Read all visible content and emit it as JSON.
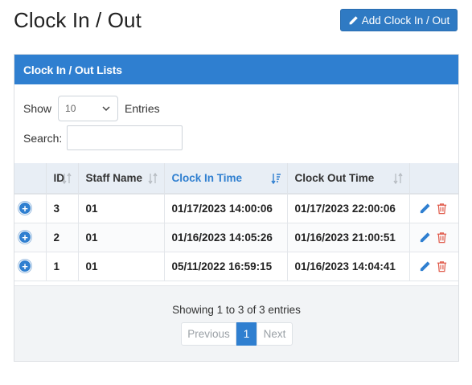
{
  "page": {
    "title": "Clock In / Out"
  },
  "toolbar": {
    "add_label": "Add Clock In / Out"
  },
  "card": {
    "header": "Clock In / Out Lists"
  },
  "controls": {
    "show_label": "Show",
    "entries_value": "10",
    "entries_label": "Entries",
    "search_label": "Search:",
    "search_value": ""
  },
  "table": {
    "columns": [
      "",
      "ID",
      "Staff Name",
      "Clock In Time",
      "Clock Out Time",
      ""
    ],
    "sorted_column": "Clock In Time",
    "rows": [
      {
        "id": "3",
        "staff": "01",
        "clock_in": "01/17/2023 14:00:06",
        "clock_out": "01/17/2023 22:00:06"
      },
      {
        "id": "2",
        "staff": "01",
        "clock_in": "01/16/2023 14:05:26",
        "clock_out": "01/16/2023 21:00:51"
      },
      {
        "id": "1",
        "staff": "01",
        "clock_in": "05/11/2022 16:59:15",
        "clock_out": "01/16/2023 14:04:41"
      }
    ]
  },
  "footer": {
    "info": "Showing 1 to 3 of 3 entries",
    "pagination": {
      "previous": "Previous",
      "current": "1",
      "next": "Next"
    }
  },
  "colors": {
    "primary": "#2f7fd0",
    "delete": "#e05a4a"
  }
}
